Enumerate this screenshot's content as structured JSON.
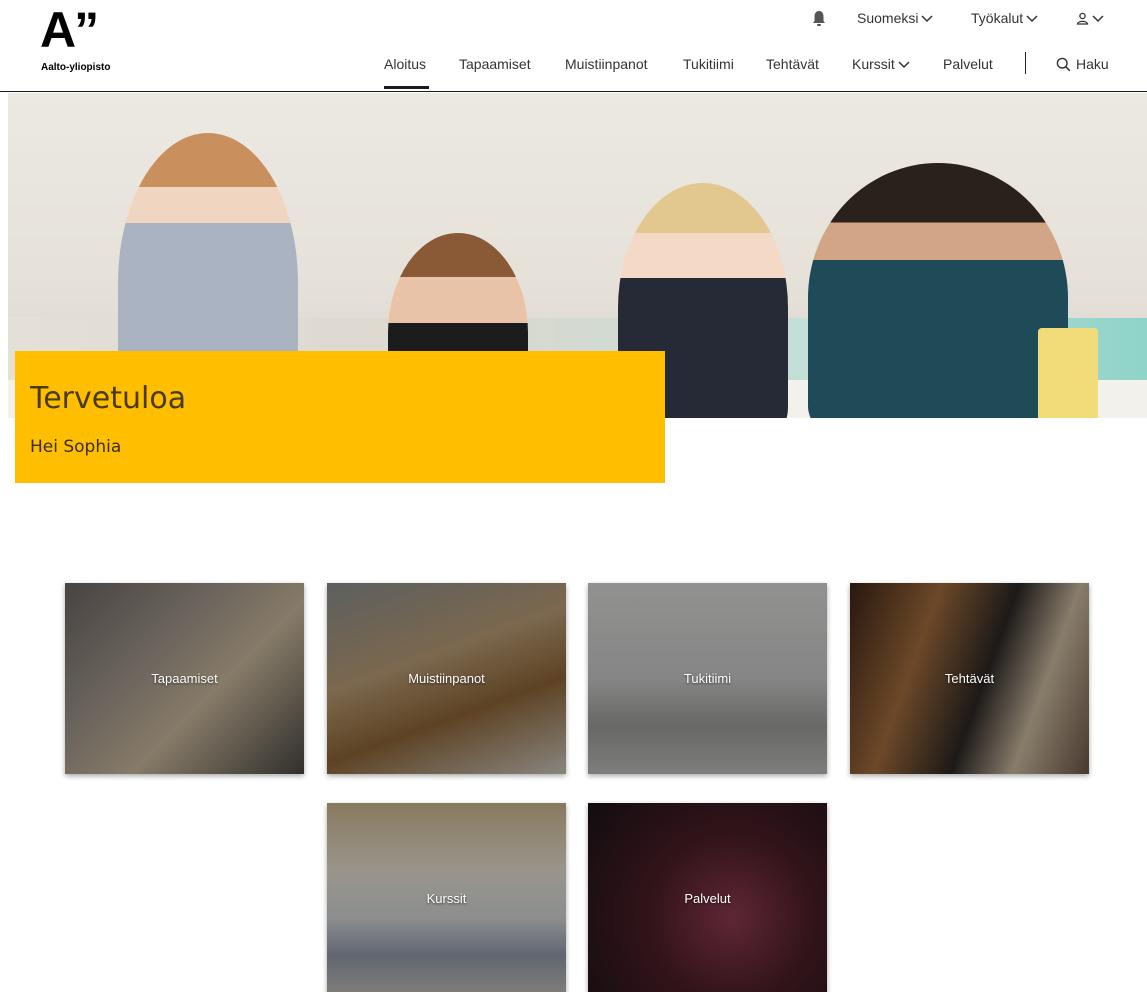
{
  "brand": {
    "logo_mark": "A”",
    "logo_text": "Aalto-yliopisto"
  },
  "utility": {
    "notifications_icon": "bell-icon",
    "language_label": "Suomeksi",
    "tools_label": "Työkalut",
    "user_icon": "user-icon"
  },
  "nav": {
    "items": [
      {
        "label": "Aloitus",
        "active": true
      },
      {
        "label": "Tapaamiset"
      },
      {
        "label": "Muistiinpanot"
      },
      {
        "label": "Tukitiimi"
      },
      {
        "label": "Tehtävät"
      },
      {
        "label": "Kurssit",
        "dropdown": true
      },
      {
        "label": "Palvelut"
      }
    ],
    "search_label": "Haku",
    "search_icon": "search-icon"
  },
  "hero": {
    "title": "Tervetuloa",
    "greeting": "Hei Sophia"
  },
  "tiles": [
    {
      "label": "Tapaamiset"
    },
    {
      "label": "Muistiinpanot"
    },
    {
      "label": "Tukitiimi"
    },
    {
      "label": "Tehtävät"
    },
    {
      "label": "Kurssit"
    },
    {
      "label": "Palvelut"
    }
  ],
  "colors": {
    "accent": "#ffbf00",
    "text": "#333333"
  }
}
